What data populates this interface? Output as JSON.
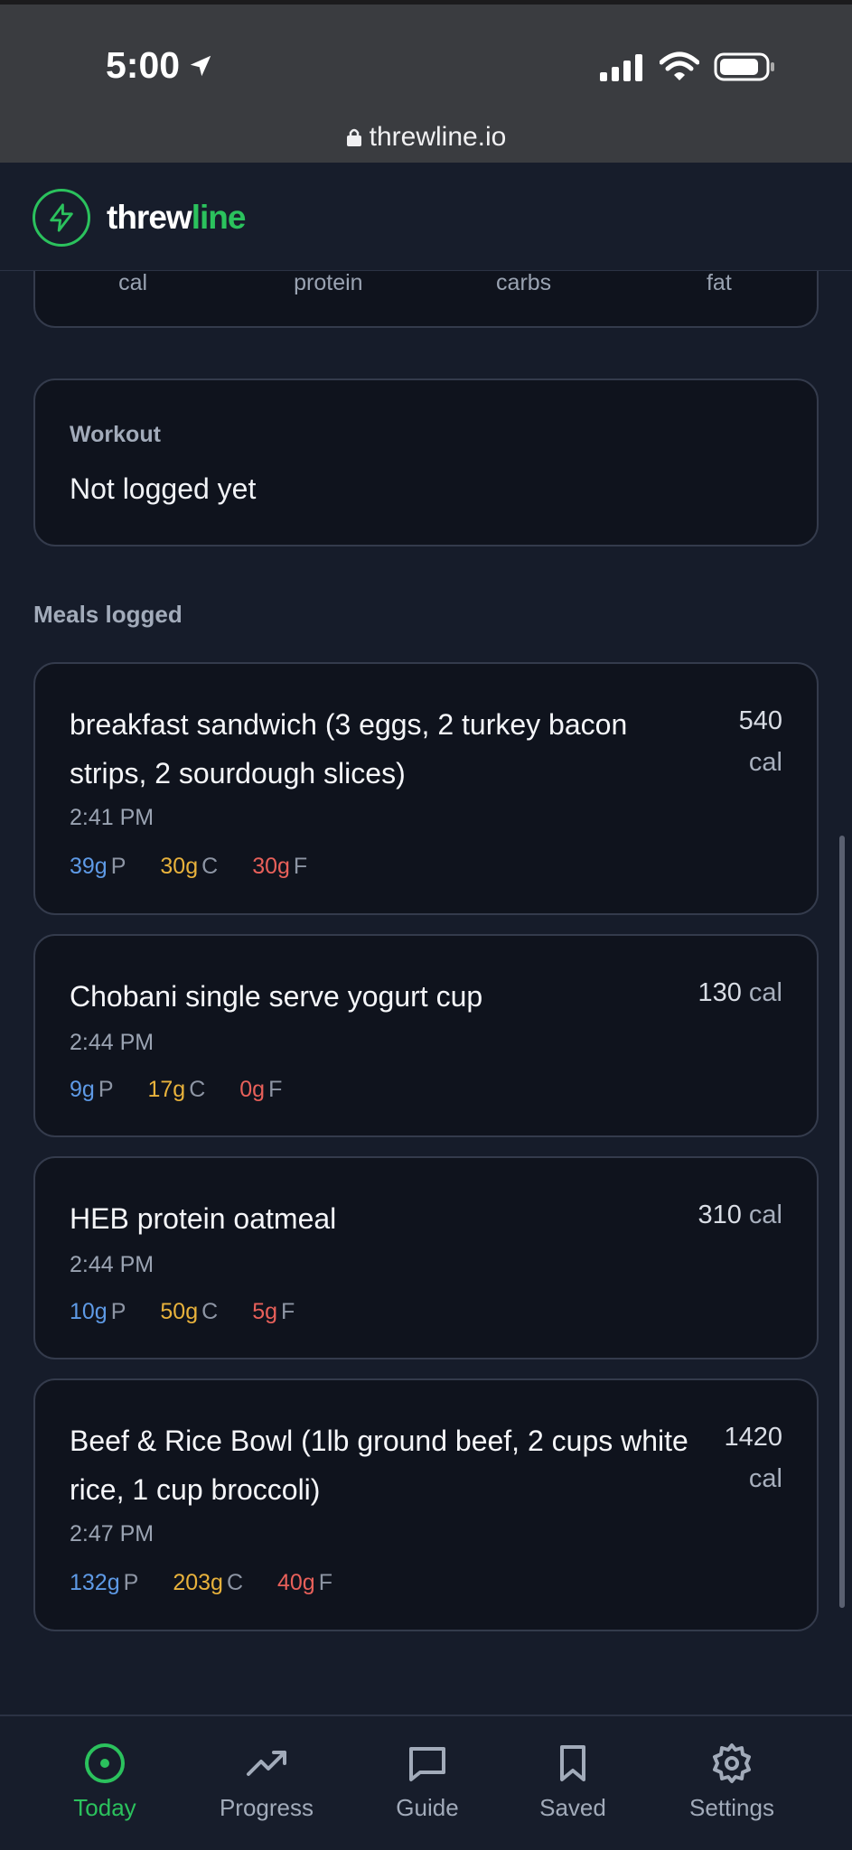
{
  "status_bar": {
    "time": "5:00",
    "url": "threwline.io"
  },
  "header": {
    "brand_part1": "threw",
    "brand_part2": "line"
  },
  "macro_summary": {
    "labels": [
      "cal",
      "protein",
      "carbs",
      "fat"
    ]
  },
  "workout": {
    "title": "Workout",
    "status": "Not logged yet"
  },
  "meals_section_label": "Meals logged",
  "meals": [
    {
      "name": "breakfast sandwich (3 eggs, 2 turkey bacon strips, 2 sourdough slices)",
      "cal": "540",
      "cal_unit": "cal",
      "time": "2:41 PM",
      "protein": "39g",
      "carbs": "30g",
      "fat": "30g"
    },
    {
      "name": "Chobani single serve yogurt cup",
      "cal": "130",
      "cal_unit": "cal",
      "time": "2:44 PM",
      "protein": "9g",
      "carbs": "17g",
      "fat": "0g"
    },
    {
      "name": "HEB protein oatmeal",
      "cal": "310",
      "cal_unit": "cal",
      "time": "2:44 PM",
      "protein": "10g",
      "carbs": "50g",
      "fat": "5g"
    },
    {
      "name": "Beef & Rice Bowl (1lb ground beef, 2 cups white rice, 1 cup broccoli)",
      "cal": "1420",
      "cal_unit": "cal",
      "time": "2:47 PM",
      "protein": "132g",
      "carbs": "203g",
      "fat": "40g"
    }
  ],
  "macro_letters": {
    "p": "P",
    "c": "C",
    "f": "F"
  },
  "nav": [
    {
      "label": "Today",
      "icon": "target-icon",
      "active": true
    },
    {
      "label": "Progress",
      "icon": "trending-up-icon",
      "active": false
    },
    {
      "label": "Guide",
      "icon": "chat-bubble-icon",
      "active": false
    },
    {
      "label": "Saved",
      "icon": "bookmark-icon",
      "active": false
    },
    {
      "label": "Settings",
      "icon": "gear-icon",
      "active": false
    }
  ],
  "colors": {
    "accent": "#2bc25d",
    "protein": "#5e9ae6",
    "carbs": "#e8b23c",
    "fat": "#e8605a"
  }
}
